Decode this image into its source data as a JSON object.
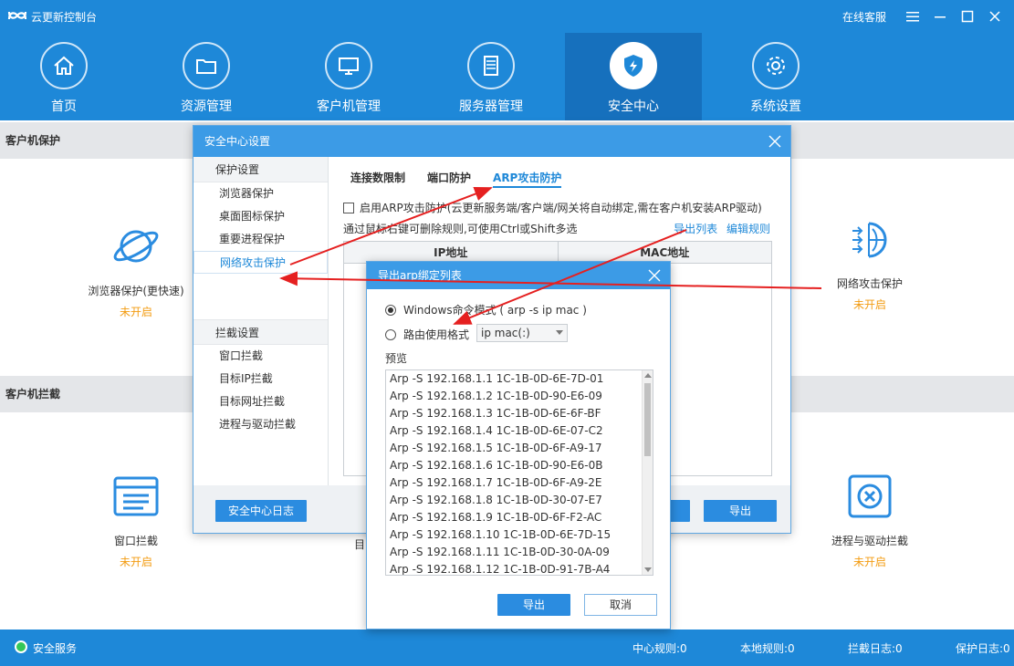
{
  "window": {
    "title": "云更新控制台",
    "online_service": "在线客服"
  },
  "nav": [
    {
      "label": "首页",
      "icon": "home-icon"
    },
    {
      "label": "资源管理",
      "icon": "folder-icon"
    },
    {
      "label": "客户机管理",
      "icon": "monitor-icon"
    },
    {
      "label": "服务器管理",
      "icon": "server-icon"
    },
    {
      "label": "安全中心",
      "icon": "shield-icon",
      "active": true
    },
    {
      "label": "系统设置",
      "icon": "gear-icon"
    }
  ],
  "sections": {
    "client_protection": "客户机保护",
    "client_block": "客户机拦截"
  },
  "features": {
    "browser_protection": {
      "label": "浏览器保护(更快速)",
      "status": "未开启"
    },
    "network_attack": {
      "label": "网络攻击保护",
      "status": "未开启"
    },
    "window_block": {
      "label": "窗口拦截",
      "status": "未开启"
    },
    "target_partial": "目",
    "process_driver": {
      "label": "进程与驱动拦截",
      "status": "未开启"
    }
  },
  "status_bar": {
    "service": "安全服务",
    "center_rules": "中心规则:0",
    "local_rules": "本地规则:0",
    "block_log": "拦截日志:0",
    "protect_log": "保护日志:0"
  },
  "settings_dialog": {
    "title": "安全中心设置",
    "protection_group": "保护设置",
    "protection_items": [
      "浏览器保护",
      "桌面图标保护",
      "重要进程保护",
      "网络攻击保护"
    ],
    "block_group": "拦截设置",
    "block_items": [
      "窗口拦截",
      "目标IP拦截",
      "目标网址拦截",
      "进程与驱动拦截"
    ],
    "tabs": [
      "连接数限制",
      "端口防护",
      "ARP攻击防护"
    ],
    "enable_arp": "启用ARP攻击防护(云更新服务端/客户端/网关将自动绑定,需在客户机安装ARP驱动)",
    "hint": "通过鼠标右键可删除规则,可使用Ctrl或Shift多选",
    "export_list": "导出列表",
    "edit_rules": "编辑规则",
    "col_ip": "IP地址",
    "col_mac": "MAC地址",
    "log_button": "安全中心日志",
    "export_button": "导出"
  },
  "export_dialog": {
    "title": "导出arp绑定列表",
    "option_windows": "Windows命令模式 ( arp -s ip mac )",
    "option_router": "路由使用格式",
    "router_format": "ip mac(:)",
    "preview_label": "预览",
    "preview_lines": [
      "Arp -S 192.168.1.1 1C-1B-0D-6E-7D-01",
      "Arp -S 192.168.1.2 1C-1B-0D-90-E6-09",
      "Arp -S 192.168.1.3 1C-1B-0D-6E-6F-BF",
      "Arp -S 192.168.1.4 1C-1B-0D-6E-07-C2",
      "Arp -S 192.168.1.5 1C-1B-0D-6F-A9-17",
      "Arp -S 192.168.1.6 1C-1B-0D-90-E6-0B",
      "Arp -S 192.168.1.7 1C-1B-0D-6F-A9-2E",
      "Arp -S 192.168.1.8 1C-1B-0D-30-07-E7",
      "Arp -S 192.168.1.9 1C-1B-0D-6F-F2-AC",
      "Arp -S 192.168.1.10 1C-1B-0D-6E-7D-15",
      "Arp -S 192.168.1.11 1C-1B-0D-30-0A-09",
      "Arp -S 192.168.1.12 1C-1B-0D-91-7B-A4"
    ],
    "export_button": "导出",
    "cancel_button": "取消"
  },
  "colors": {
    "primary": "#1e88d8",
    "active_nav": "#1670bd",
    "status_orange": "#f39c12",
    "annotation_arrow": "#e52020"
  }
}
